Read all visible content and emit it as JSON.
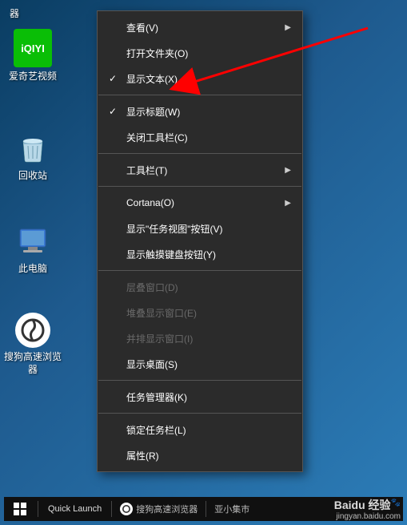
{
  "top_text": "器",
  "shortcuts": {
    "iqiyi": {
      "label": "爱奇艺视频",
      "icon_text": "iQIYI"
    },
    "recycle": {
      "label": "回收站"
    },
    "thispc": {
      "label": "此电脑"
    },
    "browser": {
      "label": "搜狗高速浏览器"
    }
  },
  "context_menu": {
    "items": [
      {
        "label": "查看(V)",
        "submenu": true
      },
      {
        "label": "打开文件夹(O)"
      },
      {
        "label": "显示文本(X)",
        "checked": true
      },
      {
        "label": "显示标题(W)",
        "checked": true,
        "sep_before": true
      },
      {
        "label": "关闭工具栏(C)"
      },
      {
        "label": "工具栏(T)",
        "submenu": true,
        "sep_before": true
      },
      {
        "label": "Cortana(O)",
        "submenu": true,
        "sep_before": true
      },
      {
        "label": "显示\"任务视图\"按钮(V)"
      },
      {
        "label": "显示触摸键盘按钮(Y)"
      },
      {
        "label": "层叠窗口(D)",
        "disabled": true,
        "sep_before": true
      },
      {
        "label": "堆叠显示窗口(E)",
        "disabled": true
      },
      {
        "label": "并排显示窗口(I)",
        "disabled": true
      },
      {
        "label": "显示桌面(S)"
      },
      {
        "label": "任务管理器(K)",
        "sep_before": true
      },
      {
        "label": "锁定任务栏(L)",
        "sep_before": true
      },
      {
        "label": "属性(R)"
      }
    ]
  },
  "taskbar": {
    "quick_launch": "Quick Launch",
    "app1": "搜狗高速浏览器",
    "app2": "亚小集巿"
  },
  "watermark": {
    "brand": "Baidu 经验",
    "url": "jingyan.baidu.com"
  }
}
